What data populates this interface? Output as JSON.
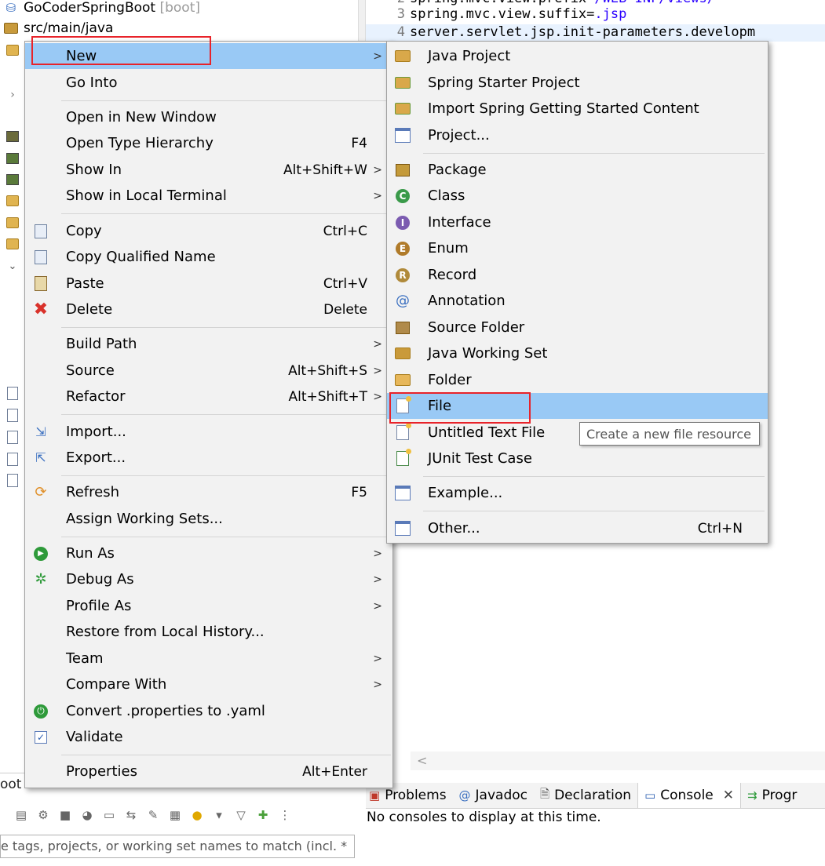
{
  "explorer": {
    "project_name": "GoCoderSpringBoot",
    "project_tag": "[boot]",
    "src_folder": "src/main/java"
  },
  "editor": {
    "lines": [
      {
        "num": "2",
        "key": "spring.mvc.view.prefix=",
        "value": "/WEB-INF/views/"
      },
      {
        "num": "3",
        "key": "spring.mvc.view.suffix=",
        "value": ".jsp"
      },
      {
        "num": "4",
        "key": "server.servlet.jsp.init-parameters.developm",
        "value": ""
      }
    ],
    "scroll_arrow": "<"
  },
  "context_menu": {
    "items": [
      {
        "label": "New",
        "accel": "",
        "submenu": true,
        "icon": "none"
      },
      {
        "label": "Go Into",
        "accel": "",
        "submenu": false,
        "icon": "none"
      },
      {
        "label": "Open in New Window",
        "accel": "",
        "submenu": false,
        "icon": "none"
      },
      {
        "label": "Open Type Hierarchy",
        "accel": "F4",
        "submenu": false,
        "icon": "none"
      },
      {
        "label": "Show In",
        "accel": "Alt+Shift+W",
        "submenu": true,
        "icon": "none"
      },
      {
        "label": "Show in Local Terminal",
        "accel": "",
        "submenu": true,
        "icon": "none"
      },
      {
        "label": "Copy",
        "accel": "Ctrl+C",
        "submenu": false,
        "icon": "copy-icon"
      },
      {
        "label": "Copy Qualified Name",
        "accel": "",
        "submenu": false,
        "icon": "copy-qualified-name-icon"
      },
      {
        "label": "Paste",
        "accel": "Ctrl+V",
        "submenu": false,
        "icon": "paste-icon"
      },
      {
        "label": "Delete",
        "accel": "Delete",
        "submenu": false,
        "icon": "delete-icon"
      },
      {
        "label": "Build Path",
        "accel": "",
        "submenu": true,
        "icon": "none"
      },
      {
        "label": "Source",
        "accel": "Alt+Shift+S",
        "submenu": true,
        "icon": "none"
      },
      {
        "label": "Refactor",
        "accel": "Alt+Shift+T",
        "submenu": true,
        "icon": "none"
      },
      {
        "label": "Import...",
        "accel": "",
        "submenu": false,
        "icon": "import-icon"
      },
      {
        "label": "Export...",
        "accel": "",
        "submenu": false,
        "icon": "export-icon"
      },
      {
        "label": "Refresh",
        "accel": "F5",
        "submenu": false,
        "icon": "refresh-icon"
      },
      {
        "label": "Assign Working Sets...",
        "accel": "",
        "submenu": false,
        "icon": "none"
      },
      {
        "label": "Run As",
        "accel": "",
        "submenu": true,
        "icon": "run-icon"
      },
      {
        "label": "Debug As",
        "accel": "",
        "submenu": true,
        "icon": "bug-icon"
      },
      {
        "label": "Profile As",
        "accel": "",
        "submenu": true,
        "icon": "none"
      },
      {
        "label": "Restore from Local History...",
        "accel": "",
        "submenu": false,
        "icon": "none"
      },
      {
        "label": "Team",
        "accel": "",
        "submenu": true,
        "icon": "none"
      },
      {
        "label": "Compare With",
        "accel": "",
        "submenu": true,
        "icon": "none"
      },
      {
        "label": "Convert .properties to .yaml",
        "accel": "",
        "submenu": false,
        "icon": "power-icon"
      },
      {
        "label": "Validate",
        "accel": "",
        "submenu": false,
        "icon": "check-icon"
      },
      {
        "label": "Properties",
        "accel": "Alt+Enter",
        "submenu": false,
        "icon": "none"
      }
    ],
    "highlighted": "New"
  },
  "new_submenu": {
    "items": [
      {
        "label": "Java Project",
        "accel": "",
        "icon": "java-project-icon"
      },
      {
        "label": "Spring Starter Project",
        "accel": "",
        "icon": "spring-starter-icon"
      },
      {
        "label": "Import Spring Getting Started Content",
        "accel": "",
        "icon": "spring-import-icon"
      },
      {
        "label": "Project...",
        "accel": "",
        "icon": "project-icon"
      },
      {
        "label": "Package",
        "accel": "",
        "icon": "package-icon"
      },
      {
        "label": "Class",
        "accel": "",
        "icon": "class-icon"
      },
      {
        "label": "Interface",
        "accel": "",
        "icon": "interface-icon"
      },
      {
        "label": "Enum",
        "accel": "",
        "icon": "enum-icon"
      },
      {
        "label": "Record",
        "accel": "",
        "icon": "record-icon"
      },
      {
        "label": "Annotation",
        "accel": "",
        "icon": "annotation-icon"
      },
      {
        "label": "Source Folder",
        "accel": "",
        "icon": "source-folder-icon"
      },
      {
        "label": "Java Working Set",
        "accel": "",
        "icon": "working-set-icon"
      },
      {
        "label": "Folder",
        "accel": "",
        "icon": "folder-icon"
      },
      {
        "label": "File",
        "accel": "",
        "icon": "file-icon"
      },
      {
        "label": "Untitled Text File",
        "accel": "",
        "icon": "text-file-icon"
      },
      {
        "label": "JUnit Test Case",
        "accel": "",
        "icon": "junit-icon"
      },
      {
        "label": "Example...",
        "accel": "",
        "icon": "example-icon"
      },
      {
        "label": "Other...",
        "accel": "Ctrl+N",
        "icon": "other-icon"
      }
    ],
    "highlighted": "File"
  },
  "tooltip": "Create a new file resource",
  "boot_dashboard": {
    "tab_label": "oot Dashboard",
    "filter_placeholder": "e tags, projects, or working set names to match (incl. *"
  },
  "console_view": {
    "tabs": [
      "Problems",
      "Javadoc",
      "Declaration",
      "Console",
      "Progr"
    ],
    "active_tab": "Console",
    "message": "No consoles to display at this time."
  },
  "colors": {
    "menu_bg": "#f2f2f2",
    "highlight": "#99c9f5",
    "annotation_red": "#e8232a",
    "string_value": "#2a00ff"
  }
}
